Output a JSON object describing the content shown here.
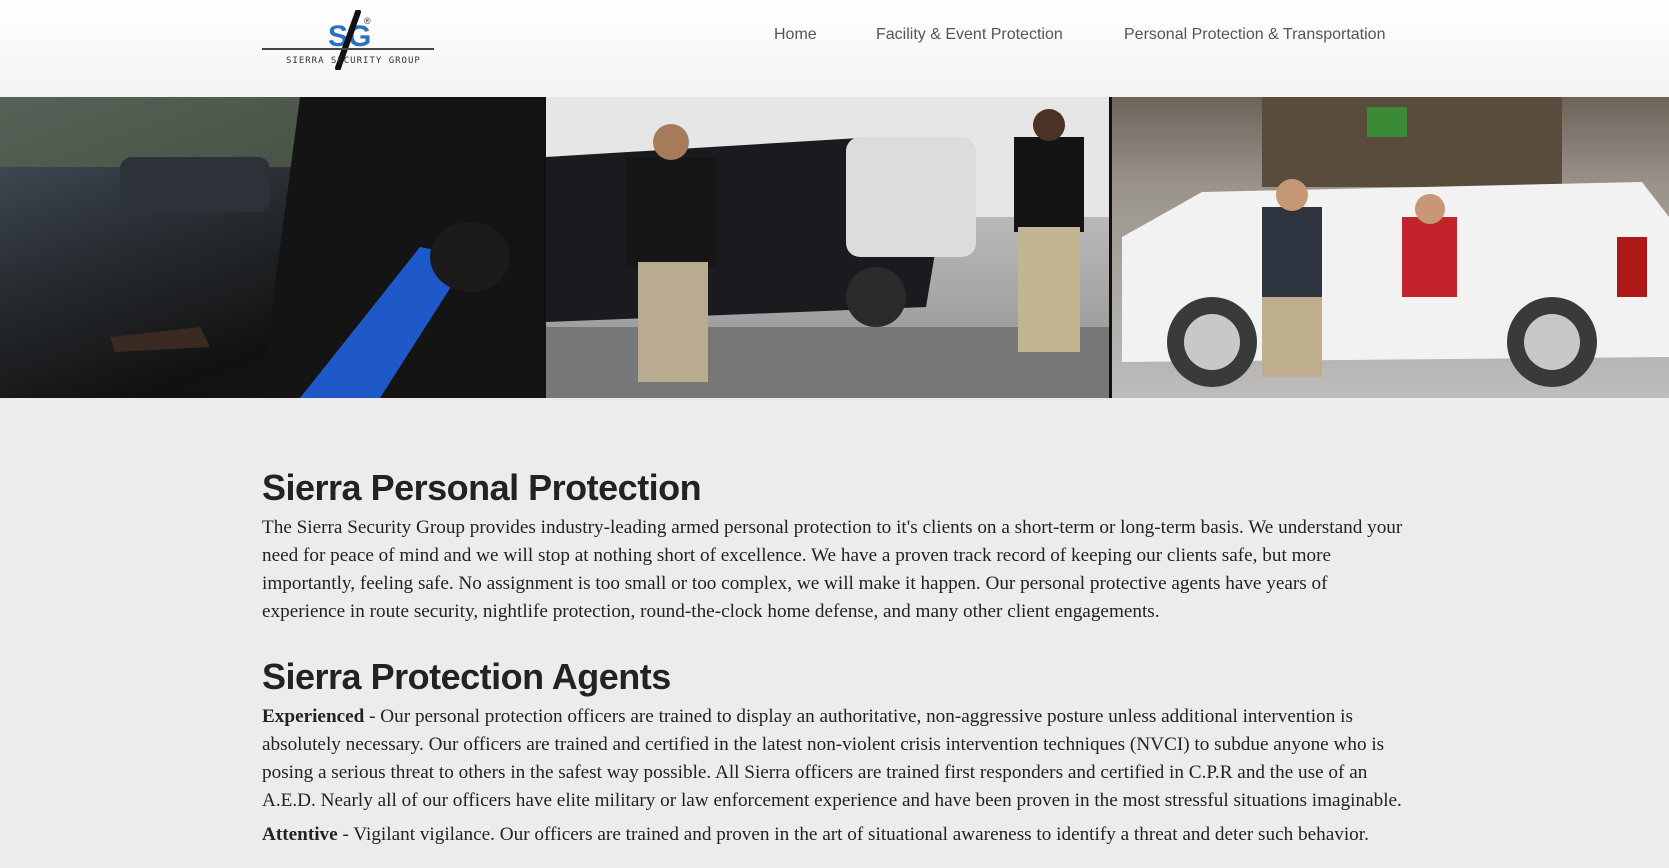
{
  "brand": {
    "logo_mark": "SG",
    "logo_text": "SIERRA SECURITY GROUP",
    "logo_registered": "®"
  },
  "nav": {
    "items": [
      {
        "label": "Home"
      },
      {
        "label": "Facility & Event Protection"
      },
      {
        "label": "Personal Protection & Transportation"
      }
    ]
  },
  "hero": {
    "photos": [
      {
        "icon": "driver-photo"
      },
      {
        "icon": "agents-by-suv-photo"
      },
      {
        "icon": "client-exiting-suv-photo"
      }
    ]
  },
  "main": {
    "section1": {
      "title": "Sierra Personal Protection",
      "body": "The Sierra Security Group provides industry-leading armed personal protection to it's clients on a short-term or long-term basis. We understand your need for peace of mind and we will stop at nothing short of excellence. We have a proven track record of keeping our clients safe, but more importantly, feeling safe. No assignment is too small or too complex, we will make it happen. Our personal protective agents have years of experience in route security, nightlife protection, round-the-clock home defense, and many other client engagements."
    },
    "section2": {
      "title": "Sierra Protection Agents",
      "p1_strong": "Experienced",
      "p1_body": " - Our personal protection officers are trained to display an authoritative, non-aggressive posture unless additional intervention is absolutely necessary. Our officers are trained and certified in the latest non-violent crisis intervention techniques (NVCI) to subdue anyone who is posing a serious threat to others in the safest way possible. All Sierra officers are trained first responders and certified in C.P.R and the use of an A.E.D. Nearly all of our officers have elite military or law enforcement experience and have been proven in the most stressful situations imaginable.",
      "p2_strong": "Attentive",
      "p2_body": " - Vigilant vigilance. Our officers are trained and proven in the art of situational awareness to identify a threat and deter such behavior."
    }
  },
  "colors": {
    "page_bg": "#edebec",
    "text": "#222222",
    "nav_text": "#555555",
    "brand_blue": "#2a6fc0"
  }
}
